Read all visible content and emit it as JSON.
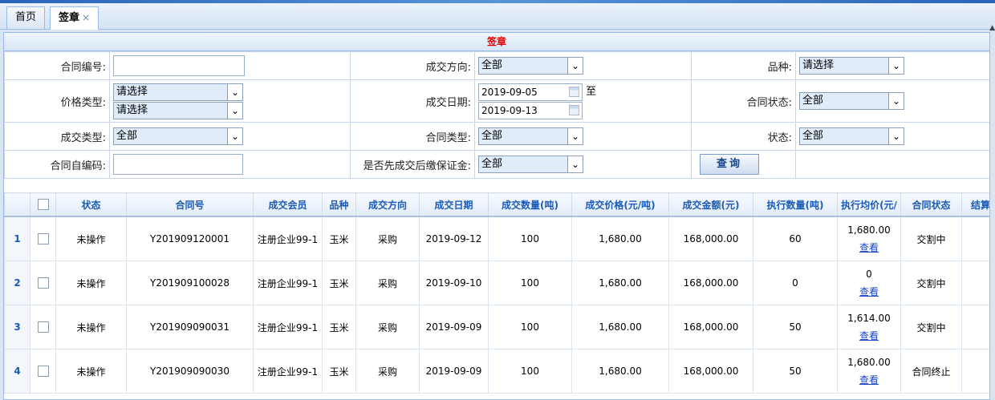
{
  "tabs": [
    {
      "label": "首页"
    },
    {
      "label": "签章",
      "close": "×"
    }
  ],
  "panel_title": "签章",
  "form": {
    "contract_no": {
      "label": "合同编号:",
      "value": ""
    },
    "direction": {
      "label": "成交方向:",
      "value": "全部"
    },
    "variety": {
      "label": "品种:",
      "value": "请选择"
    },
    "price_type": {
      "label": "价格类型:",
      "value1": "请选择",
      "value2": "请选择"
    },
    "deal_date": {
      "label": "成交日期:",
      "from": "2019-09-05",
      "to_label": "至",
      "to": "2019-09-13"
    },
    "contract_status": {
      "label": "合同状态:",
      "value": "全部"
    },
    "deal_type": {
      "label": "成交类型:",
      "value": "全部"
    },
    "contract_type": {
      "label": "合同类型:",
      "value": "全部"
    },
    "status": {
      "label": "状态:",
      "value": "全部"
    },
    "self_code": {
      "label": "合同自编码:",
      "value": ""
    },
    "deposit": {
      "label": "是否先成交后缴保证金:",
      "value": "全部"
    },
    "query_label": "查询"
  },
  "icons": {
    "dropdown": "chevron-down-icon",
    "calendar": "calendar-icon",
    "checkbox": "checkbox-icon"
  },
  "table": {
    "headers": [
      "状态",
      "合同号",
      "成交会员",
      "品种",
      "成交方向",
      "成交日期",
      "成交数量(吨)",
      "成交价格(元/吨)",
      "成交金额(元)",
      "执行数量(吨)",
      "执行均价(元/",
      "合同状态",
      "结算"
    ],
    "view_label": "查看",
    "rows": [
      {
        "no": "1",
        "status": "未操作",
        "contract": "Y201909120001",
        "member": "注册企业99-1",
        "variety": "玉米",
        "direction": "采购",
        "date": "2019-09-12",
        "qty": "100",
        "price": "1,680.00",
        "amount": "168,000.00",
        "exec_qty": "60",
        "exec_avg": "1,680.00",
        "cstatus": "交割中"
      },
      {
        "no": "2",
        "status": "未操作",
        "contract": "Y201909100028",
        "member": "注册企业99-1",
        "variety": "玉米",
        "direction": "采购",
        "date": "2019-09-10",
        "qty": "100",
        "price": "1,680.00",
        "amount": "168,000.00",
        "exec_qty": "0",
        "exec_avg": "0",
        "cstatus": "交割中"
      },
      {
        "no": "3",
        "status": "未操作",
        "contract": "Y201909090031",
        "member": "注册企业99-1",
        "variety": "玉米",
        "direction": "采购",
        "date": "2019-09-09",
        "qty": "100",
        "price": "1,680.00",
        "amount": "168,000.00",
        "exec_qty": "50",
        "exec_avg": "1,614.00",
        "cstatus": "交割中"
      },
      {
        "no": "4",
        "status": "未操作",
        "contract": "Y201909090030",
        "member": "注册企业99-1",
        "variety": "玉米",
        "direction": "采购",
        "date": "2019-09-09",
        "qty": "100",
        "price": "1,680.00",
        "amount": "168,000.00",
        "exec_qty": "50",
        "exec_avg": "1,680.00",
        "cstatus": "合同终止"
      }
    ]
  }
}
